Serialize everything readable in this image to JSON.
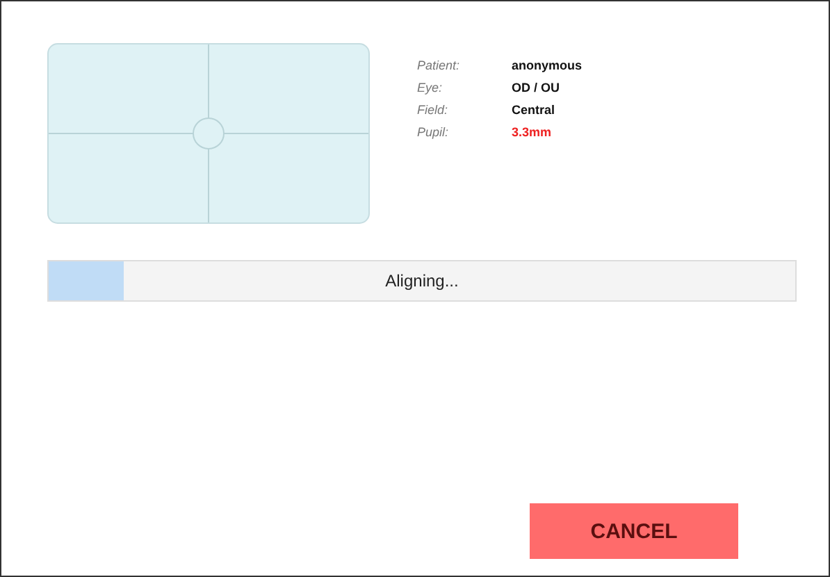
{
  "info": [
    {
      "label": "Patient:",
      "value": "anonymous",
      "alert": false
    },
    {
      "label": "Eye:",
      "value": "OD / OU",
      "alert": false
    },
    {
      "label": "Field:",
      "value": "Central",
      "alert": false
    },
    {
      "label": "Pupil:",
      "value": "3.3mm",
      "alert": true
    }
  ],
  "progress": {
    "label": "Aligning...",
    "level": 0.1
  },
  "buttons": [
    {
      "label": "CANCEL",
      "kind": "cancel"
    }
  ]
}
